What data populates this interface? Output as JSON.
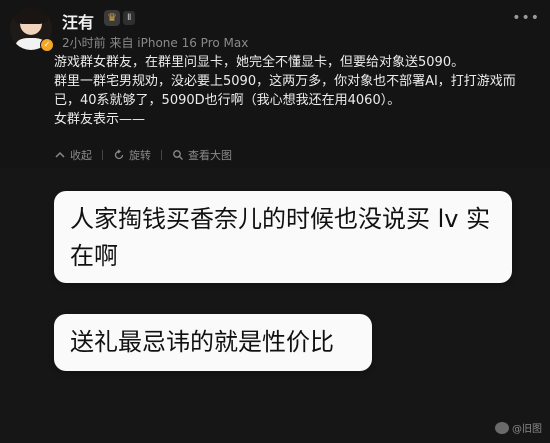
{
  "header": {
    "username": "汪有",
    "level_icon": "♛",
    "vip_label": "Ⅱ",
    "meta": "2小时前 来自 iPhone 16 Pro Max",
    "more_icon": "•••"
  },
  "post": {
    "lines": [
      "游戏群女群友，在群里问显卡，她完全不懂显卡，但要给对象送5090。",
      "群里一群宅男规劝，没必要上5090，这两万多，你对象也不部署AI，打打游戏而已，40系就够了，5090D也行啊（我心想我还在用4060）。",
      "女群友表示——"
    ]
  },
  "actions": {
    "collapse": "收起",
    "rotate": "旋转",
    "view_large": "查看大图"
  },
  "image": {
    "bubble1": "人家掏钱买香奈儿的时候也没说买 lv 实在啊",
    "bubble2": "送礼最忌讳的就是性价比",
    "watermark": "@旧图"
  }
}
